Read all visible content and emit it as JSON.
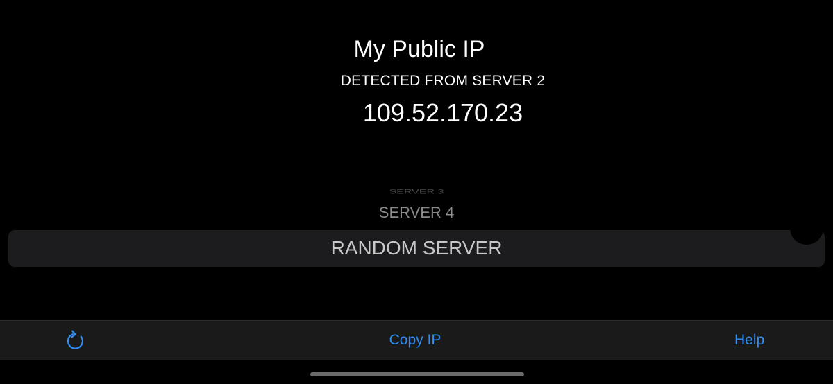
{
  "header": {
    "title": "My Public IP",
    "subtitle": "DETECTED FROM SERVER 2",
    "ip_address": "109.52.170.23"
  },
  "picker": {
    "options": [
      "SERVER 3",
      "SERVER 4",
      "RANDOM SERVER"
    ],
    "selected": "RANDOM SERVER"
  },
  "toolbar": {
    "refresh_icon": "refresh-icon",
    "copy_label": "Copy IP",
    "help_label": "Help"
  },
  "colors": {
    "background": "#000000",
    "accent": "#2f8ef5",
    "picker_highlight": "#1c1c1e",
    "toolbar_bg": "#1a1a1a"
  }
}
